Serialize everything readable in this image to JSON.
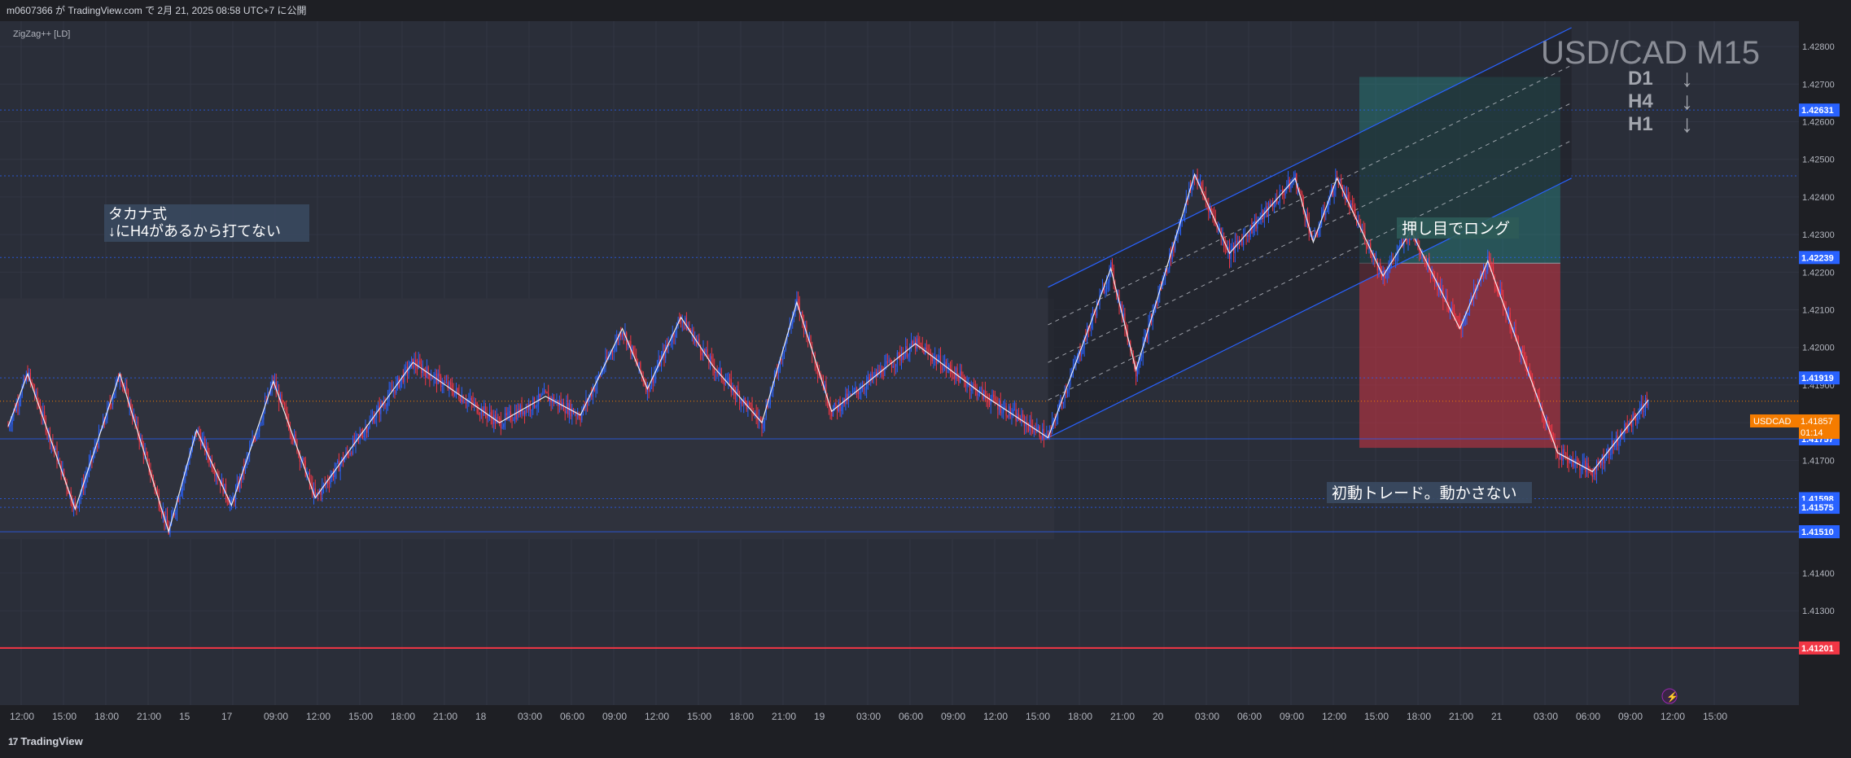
{
  "header": {
    "publish_text": "m0607366 が TradingView.com で 2月 21, 2025 08:58 UTC+7 に公開"
  },
  "indicator": {
    "label": "ZigZag++ [LD]"
  },
  "watermark": {
    "symbol_tf": "USD/CAD M15"
  },
  "trend_panel": {
    "rows": [
      {
        "tf": "D1",
        "dir": "↓"
      },
      {
        "tf": "H4",
        "dir": "↓"
      },
      {
        "tf": "H1",
        "dir": "↓"
      }
    ]
  },
  "annotations": {
    "note_line1": "タカナ式",
    "note_line2": "↓にH4があるから打てない",
    "long_label": "押し目でロング",
    "trade_label": "初動トレード。動かさない"
  },
  "price_tag": {
    "symbol": "USDCAD",
    "price": "1.41857",
    "countdown": "01:14",
    "color": "#f57c00"
  },
  "footer": {
    "brand": "TradingView"
  },
  "colors": {
    "background": "#2a2e39",
    "up_candle": "#2962ff",
    "down_candle": "#f23645",
    "zigzag": "#ffffff",
    "channel": "#2962ff",
    "target_zone": "#26a69a",
    "stop_zone": "#f23645",
    "support_line": "#f23645"
  },
  "chart_data": {
    "type": "candlestick",
    "title": "USD/CAD M15",
    "ylim": [
      1.4106,
      1.4285
    ],
    "y_ticks": [
      "1.42800",
      "1.42700",
      "1.42600",
      "1.42500",
      "1.42400",
      "1.42300",
      "1.42200",
      "1.42100",
      "1.42000",
      "1.41900",
      "1.41800",
      "1.41700",
      "1.41400",
      "1.41300"
    ],
    "x_ticks": [
      "12:00",
      "15:00",
      "18:00",
      "21:00",
      "15",
      "17",
      "09:00",
      "12:00",
      "15:00",
      "18:00",
      "21:00",
      "18",
      "03:00",
      "06:00",
      "09:00",
      "12:00",
      "15:00",
      "18:00",
      "21:00",
      "19",
      "03:00",
      "06:00",
      "09:00",
      "12:00",
      "15:00",
      "18:00",
      "21:00",
      "20",
      "03:00",
      "06:00",
      "09:00",
      "12:00",
      "15:00",
      "18:00",
      "21:00",
      "21",
      "03:00",
      "06:00",
      "09:00",
      "12:00",
      "15:00"
    ],
    "price_labels": [
      {
        "value": 1.42631,
        "text": "1.42631",
        "color": "#2962ff"
      },
      {
        "value": 1.42239,
        "text": "1.42239",
        "color": "#2962ff"
      },
      {
        "value": 1.41919,
        "text": "1.41919",
        "color": "#2962ff"
      },
      {
        "value": 1.41757,
        "text": "1.41757",
        "color": "#2962ff"
      },
      {
        "value": 1.41598,
        "text": "1.41598",
        "color": "#2962ff"
      },
      {
        "value": 1.41575,
        "text": "1.41575",
        "color": "#2962ff"
      },
      {
        "value": 1.4151,
        "text": "1.41510",
        "color": "#2962ff"
      },
      {
        "value": 1.41201,
        "text": "1.41201",
        "color": "#f23645"
      }
    ],
    "zigzag": [
      {
        "bar": 0,
        "price": 1.4179
      },
      {
        "bar": 14,
        "price": 1.4193
      },
      {
        "bar": 48,
        "price": 1.4157
      },
      {
        "bar": 80,
        "price": 1.4193
      },
      {
        "bar": 115,
        "price": 1.4151
      },
      {
        "bar": 135,
        "price": 1.4178
      },
      {
        "bar": 160,
        "price": 1.4158
      },
      {
        "bar": 190,
        "price": 1.4191
      },
      {
        "bar": 220,
        "price": 1.416
      },
      {
        "bar": 290,
        "price": 1.4196
      },
      {
        "bar": 352,
        "price": 1.418
      },
      {
        "bar": 385,
        "price": 1.4187
      },
      {
        "bar": 410,
        "price": 1.4182
      },
      {
        "bar": 440,
        "price": 1.4205
      },
      {
        "bar": 458,
        "price": 1.4189
      },
      {
        "bar": 482,
        "price": 1.4208
      },
      {
        "bar": 505,
        "price": 1.4195
      },
      {
        "bar": 540,
        "price": 1.418
      },
      {
        "bar": 565,
        "price": 1.4212
      },
      {
        "bar": 590,
        "price": 1.4183
      },
      {
        "bar": 650,
        "price": 1.4201
      },
      {
        "bar": 700,
        "price": 1.4187
      },
      {
        "bar": 745,
        "price": 1.4176
      },
      {
        "bar": 790,
        "price": 1.4221
      },
      {
        "bar": 808,
        "price": 1.4194
      },
      {
        "bar": 850,
        "price": 1.4246
      },
      {
        "bar": 875,
        "price": 1.4225
      },
      {
        "bar": 922,
        "price": 1.4245
      },
      {
        "bar": 935,
        "price": 1.4228
      },
      {
        "bar": 952,
        "price": 1.4245
      },
      {
        "bar": 985,
        "price": 1.4219
      },
      {
        "bar": 1005,
        "price": 1.4231
      },
      {
        "bar": 1040,
        "price": 1.4205
      },
      {
        "bar": 1060,
        "price": 1.4223
      },
      {
        "bar": 1110,
        "price": 1.4172
      },
      {
        "bar": 1135,
        "price": 1.4167
      },
      {
        "bar": 1175,
        "price": 1.4186
      }
    ],
    "channel": {
      "start_bar": 745,
      "start_lower": 1.4176,
      "start_upper": 1.4216,
      "end_bar": 1120,
      "end_lower": 1.4245,
      "end_upper": 1.4285
    },
    "long_position": {
      "start_bar": 968,
      "end_bar": 1112,
      "entry": 1.42224,
      "target": 1.42719,
      "stop": 1.41733
    },
    "horizontal_lines": [
      1.42631,
      1.42456,
      1.42239,
      1.41919,
      1.41757,
      1.41598,
      1.41575,
      1.4151,
      1.41201
    ],
    "current_price": 1.41857,
    "bars_total": 1280
  }
}
